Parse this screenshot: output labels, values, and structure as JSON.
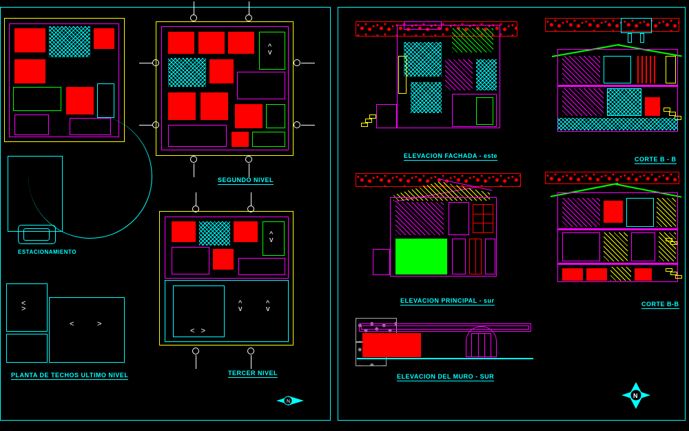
{
  "left_sheet": {
    "plan1_label": "ESTACIONAMIENTO",
    "plan_roof_label": "PLANTA DE TECHOS ULTIMO NIVEL",
    "plan2_label": "SEGUNDO NIVEL",
    "plan3_label": "TERCER NIVEL",
    "north_label": "N"
  },
  "right_sheet": {
    "elev_east": "ELEVACION FACHADA - este",
    "elev_south": "ELEVACION PRINCIPAL - sur",
    "elev_wall": "ELEVACION DEL MURO - SUR",
    "section_b": "CORTE B - B",
    "section_b2": "CORTE B-B",
    "north_label": "N"
  },
  "colors": {
    "bg": "#000000",
    "magenta": "#ff00ff",
    "yellow": "#ffff00",
    "cyan": "#00ffff",
    "red": "#ff0000",
    "green": "#00ff00",
    "white": "#ffffff"
  }
}
